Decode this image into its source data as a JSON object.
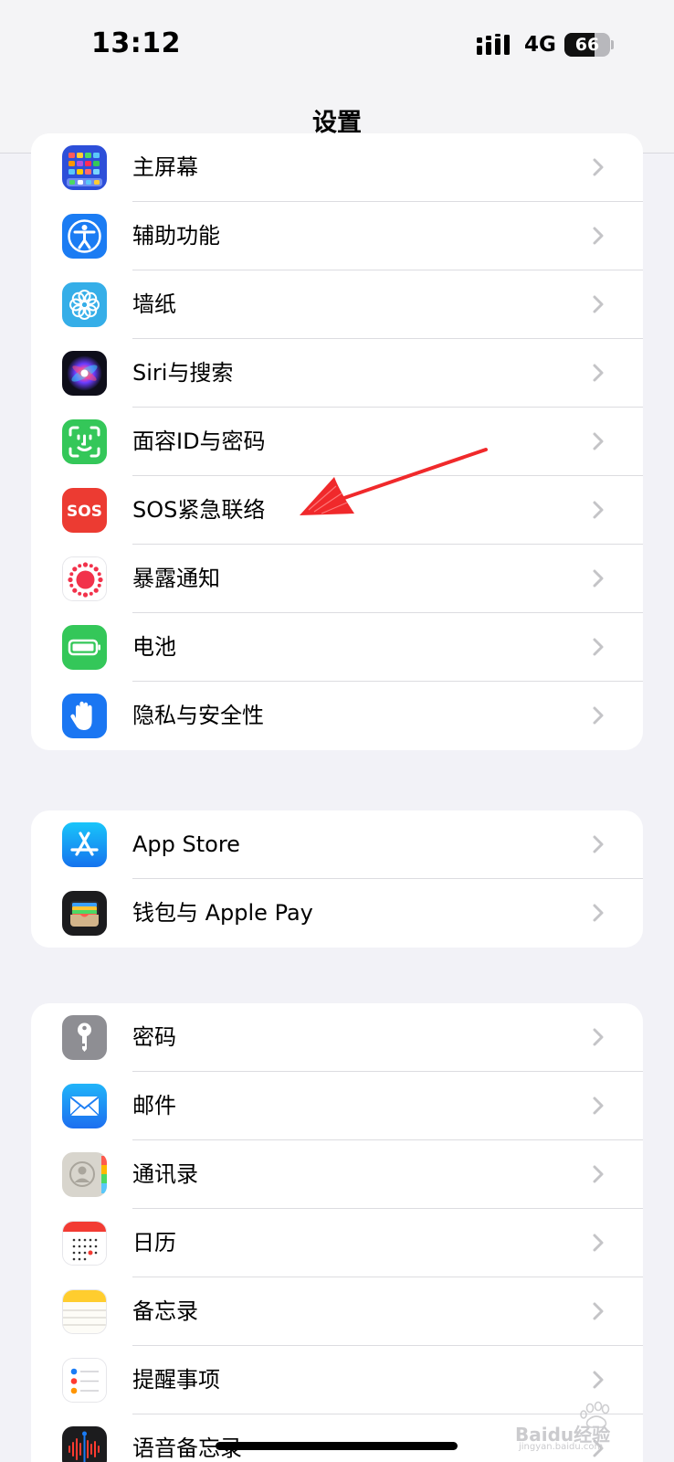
{
  "status_bar": {
    "time": "13:12",
    "network": "4G",
    "battery": "66",
    "battery_level": 0.66
  },
  "nav": {
    "title": "设置"
  },
  "groups": [
    {
      "items": [
        {
          "label": "主屏幕",
          "icon": "home-screen-icon"
        },
        {
          "label": "辅助功能",
          "icon": "accessibility-icon"
        },
        {
          "label": "墙纸",
          "icon": "wallpaper-icon"
        },
        {
          "label": "Siri与搜索",
          "icon": "siri-icon"
        },
        {
          "label": "面容ID与密码",
          "icon": "face-id-icon"
        },
        {
          "label": "SOS紧急联络",
          "icon": "sos-icon"
        },
        {
          "label": "暴露通知",
          "icon": "exposure-notification-icon"
        },
        {
          "label": "电池",
          "icon": "battery-icon"
        },
        {
          "label": "隐私与安全性",
          "icon": "privacy-hand-icon"
        }
      ]
    },
    {
      "items": [
        {
          "label": "App Store",
          "icon": "app-store-icon"
        },
        {
          "label": "钱包与 Apple Pay",
          "icon": "wallet-icon"
        }
      ]
    },
    {
      "items": [
        {
          "label": "密码",
          "icon": "key-icon"
        },
        {
          "label": "邮件",
          "icon": "mail-icon"
        },
        {
          "label": "通讯录",
          "icon": "contacts-icon"
        },
        {
          "label": "日历",
          "icon": "calendar-icon"
        },
        {
          "label": "备忘录",
          "icon": "notes-icon"
        },
        {
          "label": "提醒事项",
          "icon": "reminders-icon"
        },
        {
          "label": "语音备忘录",
          "icon": "voice-memos-icon"
        }
      ]
    }
  ],
  "watermark": {
    "logo_text": "Baidu经验",
    "sub_text": "jingyan.baidu.com"
  },
  "colors": {
    "background": "#f2f2f7",
    "annotation_arrow": "#f0292b",
    "chevron": "#c4c4c7"
  }
}
